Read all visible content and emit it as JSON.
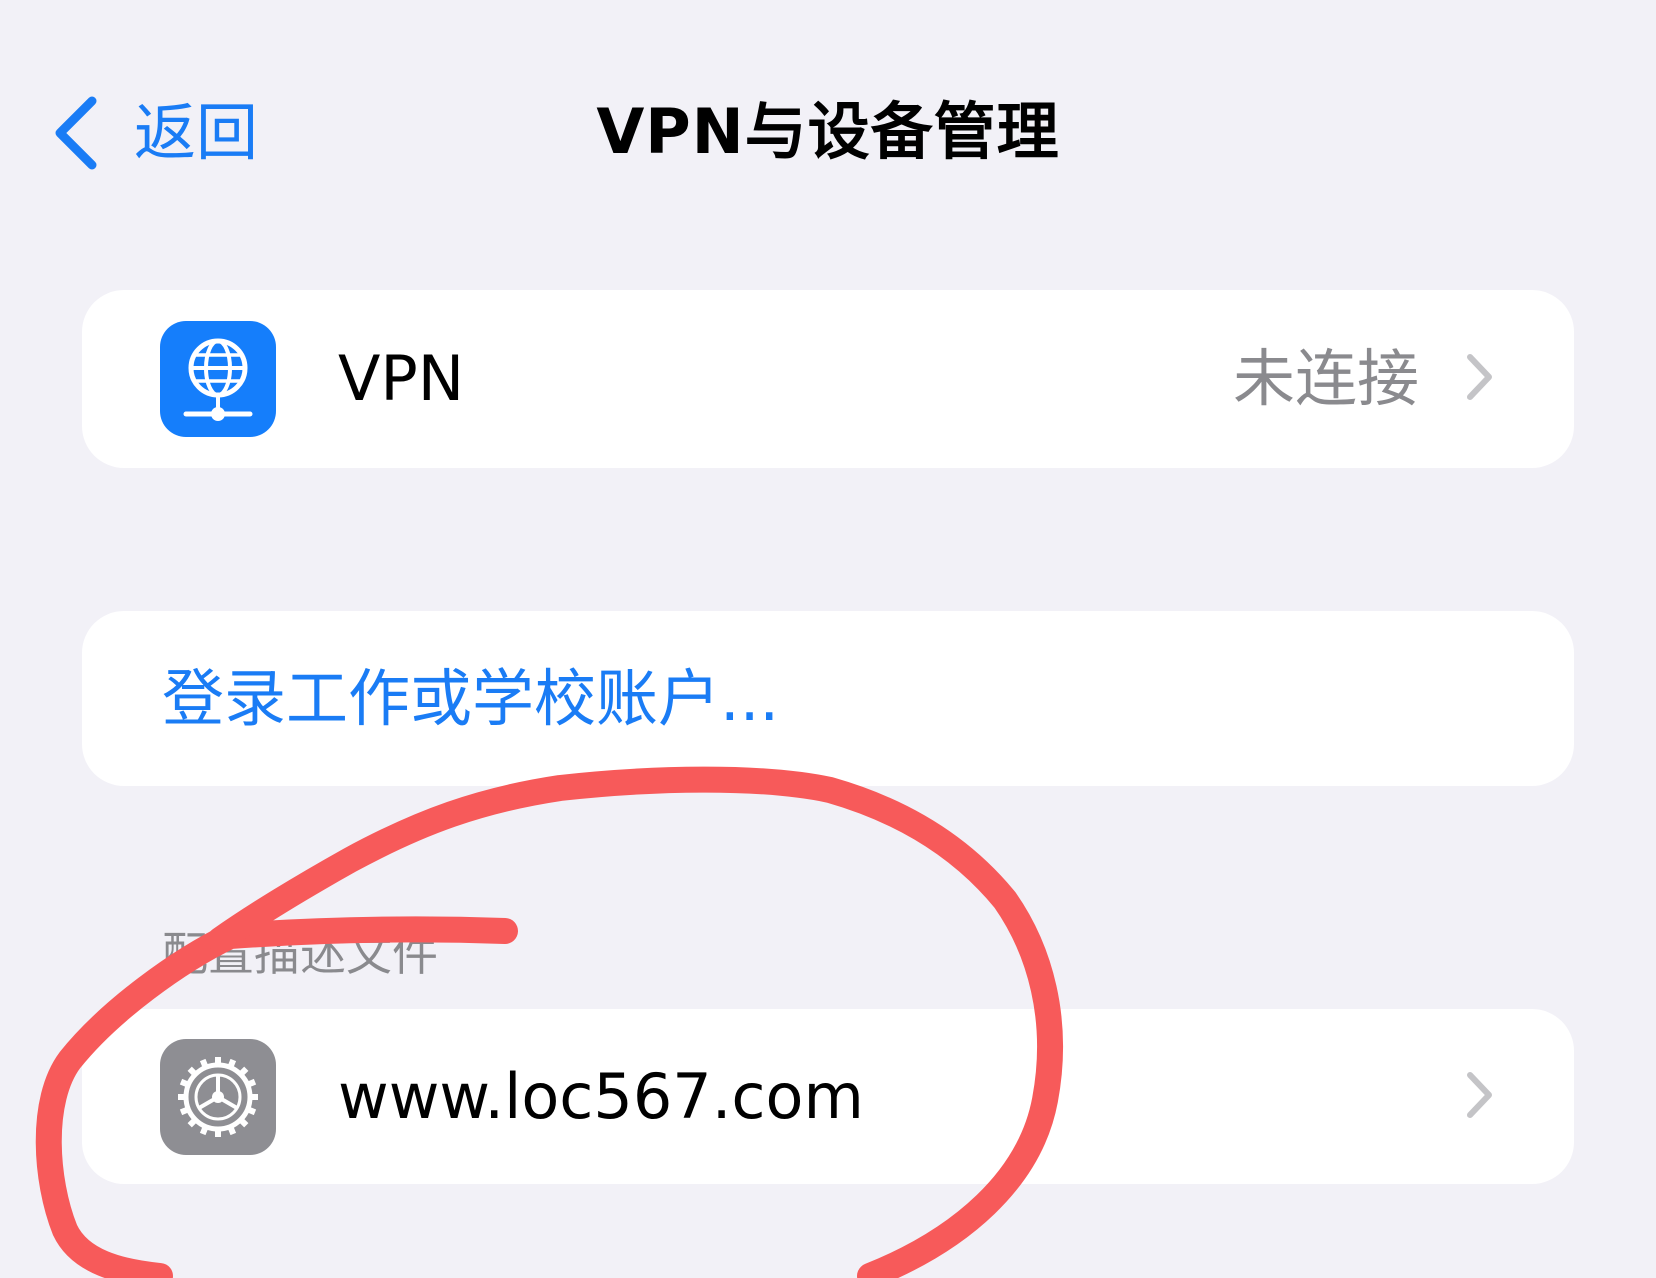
{
  "nav": {
    "back_label": "返回",
    "title": "VPN与设备管理"
  },
  "vpn_row": {
    "icon": "vpn-globe-icon",
    "label": "VPN",
    "status": "未连接"
  },
  "login_row": {
    "label": "登录工作或学校账户..."
  },
  "profiles_section": {
    "header": "配置描述文件",
    "items": [
      {
        "icon": "settings-gear-icon",
        "label": "www.loc567.com"
      }
    ]
  },
  "colors": {
    "background": "#f2f1f7",
    "accent": "#1a7cf5",
    "secondary_text": "#8a8a8e",
    "vpn_icon_bg": "#157efb",
    "settings_icon_bg": "#8e8e93",
    "annotation": "#f75a5a"
  }
}
